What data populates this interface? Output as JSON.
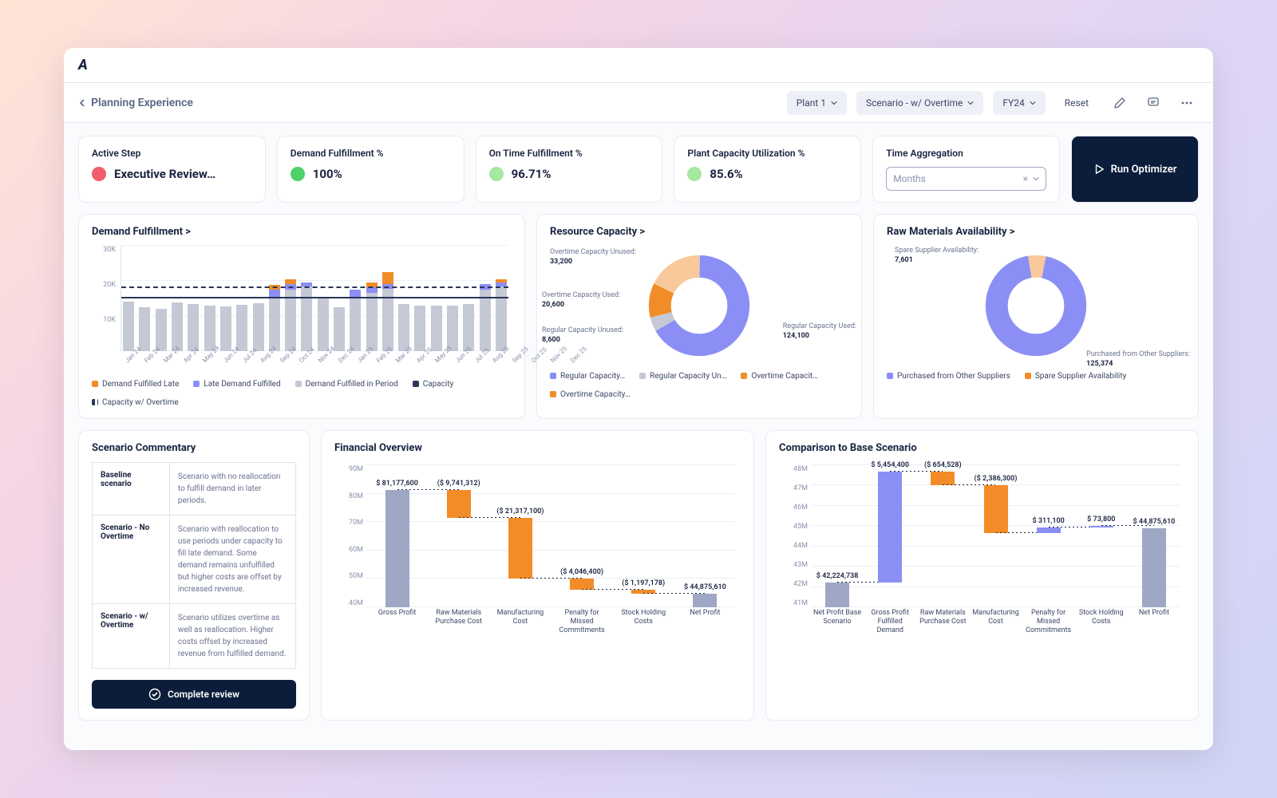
{
  "header": {
    "page_title": "Planning Experience",
    "dropdowns": {
      "plant": "Plant 1",
      "scenario": "Scenario - w/ Overtime",
      "year": "FY24"
    },
    "reset": "Reset",
    "run_optimizer": "Run Optimizer"
  },
  "kpi": {
    "active_step": {
      "label": "Active Step",
      "value": "Executive Review…",
      "color": "#f05e6b"
    },
    "demand_pct": {
      "label": "Demand Fulfillment %",
      "value": "100%",
      "color": "#4fd06a"
    },
    "ontime_pct": {
      "label": "On Time Fulfillment %",
      "value": "96.71%",
      "color": "#a6e8a1"
    },
    "capacity_pct": {
      "label": "Plant Capacity Utilization %",
      "value": "85.6%",
      "color": "#a6e8a1"
    },
    "time_agg": {
      "label": "Time Aggregation",
      "value": "Months"
    }
  },
  "demand_chart": {
    "title": "Demand Fulfillment >",
    "y_max": 30000,
    "legend": [
      "Demand Fulfilled Late",
      "Late Demand Fulfilled",
      "Demand Fulfilled in Period",
      "Capacity",
      "Capacity w/ Overtime"
    ]
  },
  "resource_donut": {
    "title": "Resource Capacity >",
    "slices": {
      "reg_used": {
        "label": "Regular Capacity Used:",
        "value": "124,100"
      },
      "reg_unused": {
        "label": "Regular Capacity Unused:",
        "value": "8,600"
      },
      "ot_used": {
        "label": "Overtime Capacity Used:",
        "value": "20,600"
      },
      "ot_unused": {
        "label": "Overtime Capacity Unused:",
        "value": "33,200"
      }
    },
    "legend": [
      "Regular Capacity…",
      "Regular Capacity Un…",
      "Overtime Capacit…",
      "Overtime Capacity…"
    ]
  },
  "rawmat_donut": {
    "title": "Raw Materials Availability >",
    "slices": {
      "purchased": {
        "label": "Purchased from Other Suppliers:",
        "value": "125,374"
      },
      "spare": {
        "label": "Spare Supplier Availability:",
        "value": "7,601"
      }
    },
    "legend": [
      "Purchased from Other Suppliers",
      "Spare Supplier Availability"
    ]
  },
  "commentary": {
    "title": "Scenario Commentary",
    "rows": [
      {
        "k": "Baseline scenario",
        "v": "Scenario with no reallocation to fulfill demand in later periods."
      },
      {
        "k": "Scenario - No Overtime",
        "v": "Scenario with reallocation to use periods under capacity to fill late demand. Some demand remains unfulfilled but higher costs are offset by increased revenue."
      },
      {
        "k": "Scenario - w/ Overtime",
        "v": "Scenario utilizes overtime as well as reallocation. Higher costs offset by increased revenue from fulfilled demand."
      }
    ],
    "complete": "Complete review"
  },
  "financial": {
    "title": "Financial Overview",
    "categories": [
      "Gross Profit",
      "Raw Materials Purchase Cost",
      "Manufacturing Cost",
      "Penalty for Missed Commitments",
      "Stock Holding Costs",
      "Net Profit"
    ],
    "labels": [
      "$ 81,177,600",
      "($ 9,741,312)",
      "($ 21,317,100)",
      "($ 4,046,400)",
      "($ 1,197,178)",
      "$ 44,875,610"
    ]
  },
  "comparison": {
    "title": "Comparison to Base Scenario",
    "categories": [
      "Net Profit Base Scenario",
      "Gross Profit Fulfilled Demand",
      "Raw Materials Purchase Cost",
      "Manufacturing Cost",
      "Penalty for Missed Commitments",
      "Stock Holding Costs",
      "Net Profit"
    ],
    "labels": [
      "$ 42,224,738",
      "$ 5,454,400",
      "($ 654,528)",
      "($ 2,386,300)",
      "$ 311,100",
      "$ 73,800",
      "$ 44,875,610"
    ]
  },
  "chart_data": [
    {
      "type": "bar",
      "title": "Demand Fulfillment",
      "ylim": [
        0,
        30000
      ],
      "yticks": [
        10000,
        20000,
        30000
      ],
      "categories": [
        "Jan 24",
        "Feb 24",
        "Mar 24",
        "Apr 24",
        "May 24",
        "Jun 24",
        "Jul 24",
        "Aug 24",
        "Sep 24",
        "Oct 24",
        "Nov 24",
        "Dec 24",
        "Jan 25",
        "Feb 25",
        "Mar 25",
        "Apr 25",
        "May 25",
        "Jun 25",
        "Jul 25",
        "Aug 25",
        "Sep 25",
        "Oct 25",
        "Nov 25",
        "Dec 25"
      ],
      "series": [
        {
          "name": "Demand Fulfilled in Period",
          "color": "#c5c9d6",
          "values": [
            14000,
            12500,
            12000,
            13800,
            13500,
            13000,
            12800,
            13200,
            13700,
            15000,
            17500,
            18500,
            15500,
            12500,
            15500,
            16500,
            17800,
            13300,
            13000,
            13000,
            13000,
            13500,
            17500,
            18500
          ]
        },
        {
          "name": "Late Demand Fulfilled",
          "color": "#8b8ff5",
          "values": [
            0,
            0,
            0,
            0,
            0,
            0,
            0,
            0,
            0,
            2500,
            1500,
            1000,
            0,
            0,
            2000,
            1800,
            1200,
            0,
            0,
            0,
            0,
            0,
            1500,
            1000
          ]
        },
        {
          "name": "Demand Fulfilled Late",
          "color": "#f28c28",
          "values": [
            0,
            0,
            0,
            0,
            0,
            0,
            0,
            0,
            0,
            1300,
            1400,
            0,
            0,
            0,
            0,
            1200,
            3500,
            0,
            0,
            0,
            0,
            0,
            0,
            1000
          ]
        }
      ],
      "lines": [
        {
          "name": "Capacity",
          "style": "solid",
          "value": 15000
        },
        {
          "name": "Capacity w/ Overtime",
          "style": "dashed",
          "value": 18000
        }
      ]
    },
    {
      "type": "pie",
      "title": "Resource Capacity",
      "series": [
        {
          "name": "Regular Capacity Used",
          "value": 124100,
          "color": "#8b8ff5"
        },
        {
          "name": "Regular Capacity Unused",
          "value": 8600,
          "color": "#c5c9d6"
        },
        {
          "name": "Overtime Capacity Used",
          "value": 20600,
          "color": "#f28c28"
        },
        {
          "name": "Overtime Capacity Unused",
          "value": 33200,
          "color": "#f9c89b"
        }
      ]
    },
    {
      "type": "pie",
      "title": "Raw Materials Availability",
      "series": [
        {
          "name": "Purchased from Other Suppliers",
          "value": 125374,
          "color": "#8b8ff5"
        },
        {
          "name": "Spare Supplier Availability",
          "value": 7601,
          "color": "#f9c89b"
        }
      ]
    },
    {
      "type": "bar",
      "title": "Financial Overview",
      "ylim": [
        40000000,
        90000000
      ],
      "yticks": [
        40000000,
        50000000,
        60000000,
        70000000,
        80000000,
        90000000
      ],
      "categories": [
        "Gross Profit",
        "Raw Materials Purchase Cost",
        "Manufacturing Cost",
        "Penalty for Missed Commitments",
        "Stock Holding Costs",
        "Net Profit"
      ],
      "values": [
        81177600,
        -9741312,
        -21317100,
        -4046400,
        -1197178,
        44875610
      ],
      "waterfall": true
    },
    {
      "type": "bar",
      "title": "Comparison to Base Scenario",
      "ylim": [
        41000000,
        48000000
      ],
      "yticks": [
        41000000,
        42000000,
        43000000,
        44000000,
        45000000,
        46000000,
        47000000,
        48000000
      ],
      "categories": [
        "Net Profit Base Scenario",
        "Gross Profit Fulfilled Demand",
        "Raw Materials Purchase Cost",
        "Manufacturing Cost",
        "Penalty for Missed Commitments",
        "Stock Holding Costs",
        "Net Profit"
      ],
      "values": [
        42224738,
        5454400,
        -654528,
        -2386300,
        311100,
        73800,
        44875610
      ],
      "waterfall": true
    }
  ]
}
